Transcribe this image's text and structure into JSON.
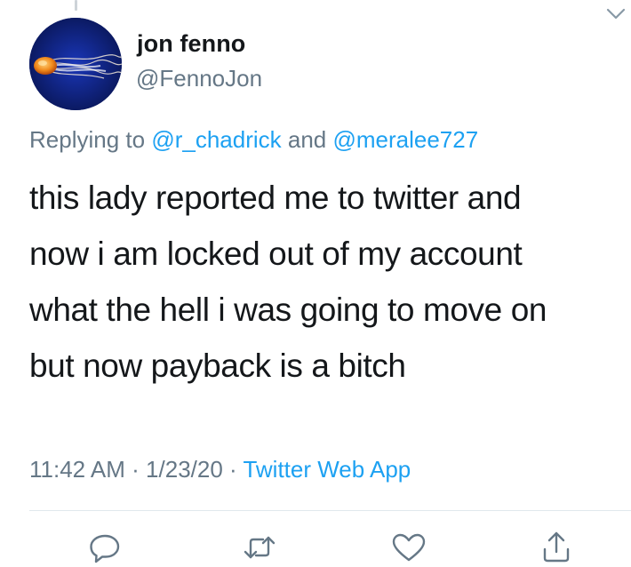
{
  "tweet": {
    "author": {
      "name": "jon fenno",
      "handle": "@FennoJon",
      "avatar": "jellyfish-avatar"
    },
    "menu_icon": "chevron-down-icon",
    "replying": {
      "prefix": "Replying to ",
      "mention_1": "@r_chadrick",
      "joiner": " and ",
      "mention_2": "@meralee727"
    },
    "text_lines": [
      "this lady reported me to twitter and",
      "now i am locked out of my account",
      "what the hell i was going to move on",
      "but now payback is a bitch"
    ],
    "meta": {
      "time": "11:42 AM",
      "separator_1": " · ",
      "date": "1/23/20",
      "separator_2": " · ",
      "source": "Twitter Web App"
    },
    "actions": [
      {
        "name": "reply",
        "icon": "reply-icon"
      },
      {
        "name": "retweet",
        "icon": "retweet-icon"
      },
      {
        "name": "like",
        "icon": "heart-icon"
      },
      {
        "name": "share",
        "icon": "share-icon"
      }
    ]
  },
  "colors": {
    "text": "#14171a",
    "secondary": "#657786",
    "link": "#1da1f2",
    "divider": "#e1e8ed"
  }
}
